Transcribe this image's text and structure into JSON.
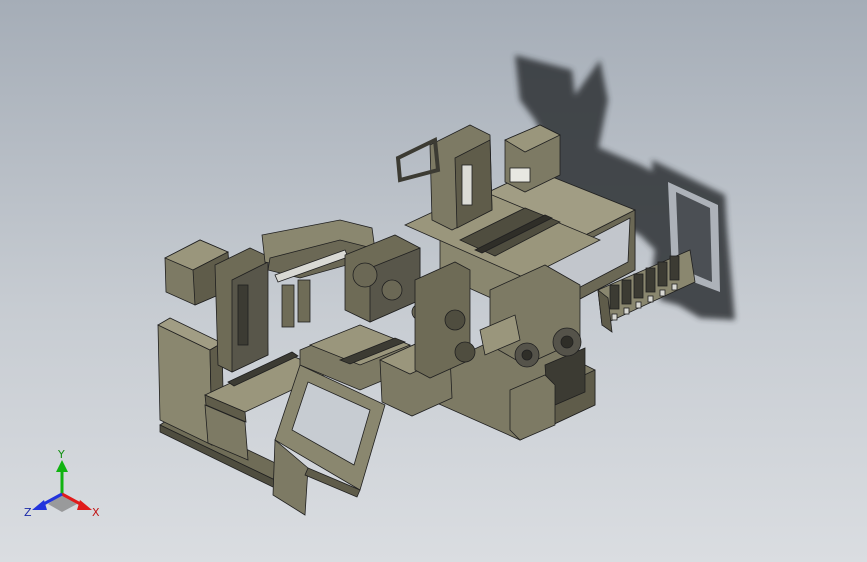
{
  "colors": {
    "background_top": "#a5adb7",
    "background_bottom": "#dadde1",
    "body": "#7d7a64",
    "body_light": "#9a967c",
    "body_dark": "#4f4d3f",
    "edge": "#202020",
    "shadow": "#2e3035",
    "axis_x": "#e01b1b",
    "axis_y": "#11b311",
    "axis_z": "#2233dd"
  },
  "triad": {
    "x_label": "X",
    "y_label": "Y",
    "z_label": "Z",
    "icon": "coordinate-triad-icon"
  }
}
